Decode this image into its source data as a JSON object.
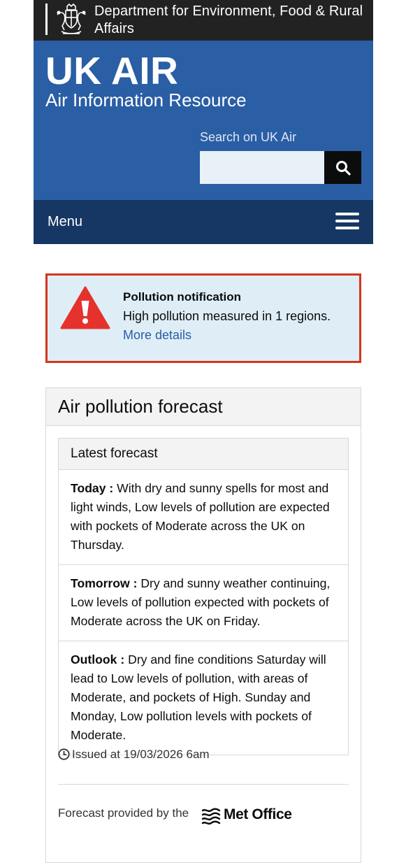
{
  "header": {
    "department": "Department for Environment, Food & Rural Affairs",
    "site_title": "UK AIR",
    "site_subtitle": "Air Information Resource",
    "search_label": "Search on UK Air",
    "search_value": ""
  },
  "nav": {
    "menu_label": "Menu"
  },
  "notification": {
    "title": "Pollution notification",
    "message": "High pollution measured in 1 regions.",
    "link": "More details",
    "border_color": "#d4351c",
    "icon": "warning-triangle-icon"
  },
  "forecast_panel": {
    "title": "Air pollution forecast",
    "subtitle": "Latest forecast",
    "items": [
      {
        "label": "Today :",
        "text": " With dry and sunny spells for most and light winds, Low levels of pollution are expected with pockets of Moderate across the UK on Thursday."
      },
      {
        "label": "Tomorrow :",
        "text": " Dry and sunny weather continuing, Low levels of pollution expected with pockets of Moderate across the UK on Friday."
      },
      {
        "label": "Outlook :",
        "text": " Dry and fine conditions Saturday will lead to Low levels of pollution, with areas of Moderate, and pockets of High. Sunday and Monday, Low pollution levels with pockets of Moderate."
      }
    ],
    "issued": "Issued at 19/03/2026 6am",
    "provider_text": "Forecast provided by the",
    "provider_logo_text": "Met Office"
  },
  "colors": {
    "defra_bar": "#222222",
    "masthead": "#2a5ea5",
    "menu_bar": "#163763",
    "alert_red": "#d4351c",
    "notification_bg": "#dfeef6",
    "link": "#2a5ea5"
  }
}
